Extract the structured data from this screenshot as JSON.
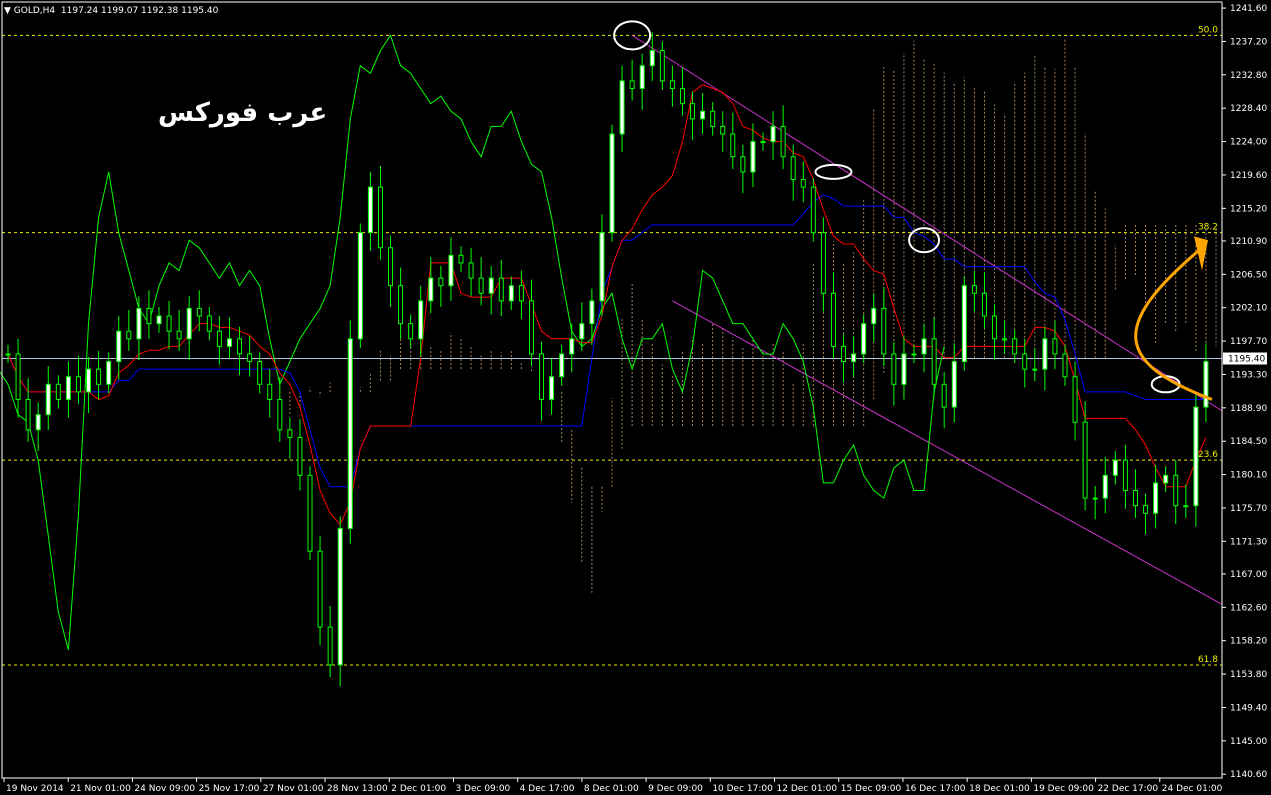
{
  "header": {
    "symbol": "GOLD,H4",
    "ohlc": "1197.24 1199.07 1192.38 1195.40"
  },
  "watermark": "عرب فوركس",
  "current_price_label": "1195.40",
  "colors": {
    "background": "#000000",
    "axis": "#ffffff",
    "bull_candle": "#ffffff",
    "bear_candle": "#00ff00",
    "chikou": "#00ff00",
    "tenkan": "#ff0000",
    "kijun": "#0000ff",
    "cloud": "#d2a679",
    "fib_line": "#f0f000",
    "channel": "#cc33cc",
    "arrow": "#ffa500",
    "current_line": "#b0c4de"
  },
  "chart_data": {
    "type": "candlestick",
    "title": "GOLD,H4",
    "y_ticks": [
      "1241.60",
      "1237.20",
      "1232.80",
      "1228.40",
      "1224.00",
      "1219.60",
      "1215.20",
      "1210.90",
      "1206.50",
      "1202.10",
      "1197.70",
      "1193.30",
      "1188.90",
      "1184.50",
      "1180.10",
      "1175.70",
      "1171.30",
      "1167.00",
      "1162.60",
      "1158.20",
      "1153.80",
      "1149.40",
      "1145.00",
      "1140.60"
    ],
    "ylim": [
      1140.1,
      1242.4
    ],
    "x_ticks": [
      "19 Nov 2014",
      "21 Nov 01:00",
      "24 Nov 09:00",
      "25 Nov 17:00",
      "27 Nov 01:00",
      "28 Nov 13:00",
      "2 Dec 01:00",
      "3 Dec 09:00",
      "4 Dec 17:00",
      "8 Dec 01:00",
      "9 Dec 09:00",
      "10 Dec 17:00",
      "12 Dec 01:00",
      "15 Dec 09:00",
      "16 Dec 17:00",
      "18 Dec 01:00",
      "19 Dec 09:00",
      "22 Dec 17:00",
      "24 Dec 01:00"
    ],
    "fib_levels": [
      {
        "label": "50.0",
        "price": 1238.0
      },
      {
        "label": "38.2",
        "price": 1212.0
      },
      {
        "label": "23.6",
        "price": 1182.0
      },
      {
        "label": "61.8",
        "price": 1155.0
      }
    ],
    "current_price": 1195.4,
    "close_series": [
      1196,
      1190,
      1186,
      1188,
      1192,
      1190,
      1193,
      1191,
      1194,
      1192,
      1195,
      1199,
      1198,
      1202,
      1200,
      1201,
      1199,
      1198,
      1202,
      1201,
      1199,
      1197,
      1198,
      1196,
      1195,
      1192,
      1190,
      1186,
      1185,
      1180,
      1170,
      1160,
      1155,
      1173,
      1198,
      1212,
      1218,
      1210,
      1205,
      1200,
      1198,
      1203,
      1206,
      1205,
      1209,
      1208,
      1206,
      1204,
      1206,
      1203,
      1205,
      1203,
      1196,
      1190,
      1193,
      1196,
      1198,
      1200,
      1203,
      1212,
      1225,
      1232,
      1231,
      1234,
      1236,
      1232,
      1231,
      1229,
      1227,
      1228,
      1226,
      1225,
      1222,
      1220,
      1224,
      1224,
      1226,
      1222,
      1219,
      1218,
      1212,
      1204,
      1197,
      1195,
      1196,
      1200,
      1202,
      1196,
      1192,
      1196,
      1196,
      1198,
      1192,
      1189,
      1195,
      1205,
      1204,
      1201,
      1198,
      1198,
      1196,
      1194,
      1194,
      1198,
      1196,
      1193,
      1187,
      1177,
      1177,
      1180,
      1182,
      1178,
      1176,
      1175,
      1179,
      1180,
      1176,
      1176,
      1189,
      1195
    ]
  }
}
